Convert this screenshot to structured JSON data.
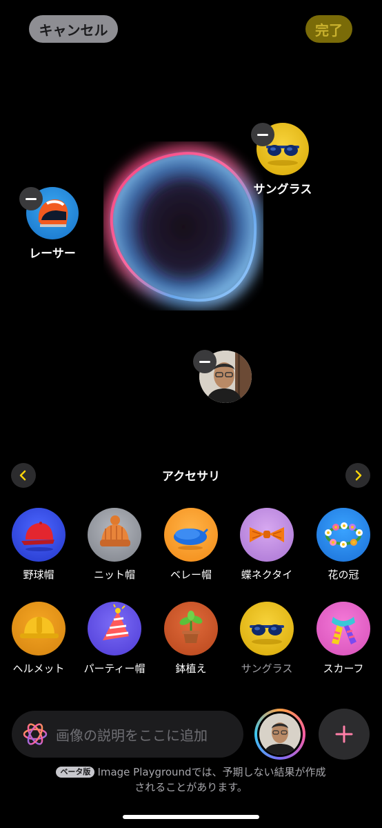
{
  "header": {
    "cancel_label": "キャンセル",
    "done_label": "完了"
  },
  "canvas": {
    "chips": {
      "sunglasses": {
        "label": "サングラス",
        "icon": "sunglasses-icon"
      },
      "racer": {
        "label": "レーサー",
        "icon": "racer-helmet-icon"
      },
      "person": {
        "icon": "person-photo"
      }
    }
  },
  "category": {
    "title": "アクセサリ",
    "prev_icon": "chevron-left-icon",
    "next_icon": "chevron-right-icon"
  },
  "accessories": {
    "row1": [
      {
        "label": "野球帽",
        "icon": "baseball-cap-icon"
      },
      {
        "label": "ニット帽",
        "icon": "knit-hat-icon"
      },
      {
        "label": "ベレー帽",
        "icon": "beret-icon"
      },
      {
        "label": "蝶ネクタイ",
        "icon": "bow-tie-icon"
      },
      {
        "label": "花の冠",
        "icon": "flower-crown-icon"
      }
    ],
    "row2": [
      {
        "label": "ヘルメット",
        "icon": "hard-hat-icon"
      },
      {
        "label": "パーティー帽",
        "icon": "party-hat-icon"
      },
      {
        "label": "鉢植え",
        "icon": "potted-plant-icon"
      },
      {
        "label": "サングラス",
        "icon": "sunglasses-icon",
        "selected": true
      },
      {
        "label": "スカーフ",
        "icon": "scarf-icon"
      }
    ]
  },
  "composer": {
    "placeholder": "画像の説明をここに追加",
    "add_icon": "plus-icon"
  },
  "footer": {
    "beta_badge": "ベータ版",
    "line1": "Image Playgroundでは、予期しない結果が作成",
    "line2": "されることがあります。"
  },
  "colors": {
    "accent_yellow": "#FFD60A",
    "cancel_bg": "#8E8E93",
    "done_bg": "#7A6B08",
    "orb_pink": "#FF4F86",
    "orb_blue": "#5AB8F0"
  }
}
